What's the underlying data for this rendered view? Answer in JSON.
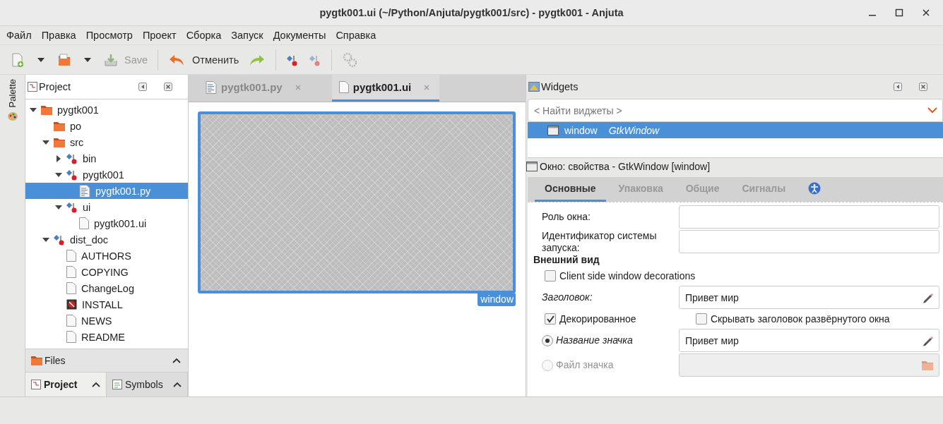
{
  "window": {
    "title": "pygtk001.ui (~/Python/Anjuta/pygtk001/src) - pygtk001 - Anjuta"
  },
  "menu": [
    "Файл",
    "Правка",
    "Просмотр",
    "Проект",
    "Сборка",
    "Запуск",
    "Документы",
    "Справка"
  ],
  "toolbar": [
    {
      "kind": "new"
    },
    {
      "kind": "dropdown"
    },
    {
      "kind": "open"
    },
    {
      "kind": "dropdown"
    },
    {
      "kind": "save",
      "label": "Save",
      "disabled": true
    },
    {
      "kind": "separator"
    },
    {
      "kind": "undo",
      "label": "Отменить",
      "disabled": false
    },
    {
      "kind": "redo",
      "disabled": false
    },
    {
      "kind": "separator"
    },
    {
      "kind": "build",
      "disabled": false
    },
    {
      "kind": "build",
      "disabled": true
    },
    {
      "kind": "separator"
    },
    {
      "kind": "gears",
      "disabled": true
    }
  ],
  "palette": {
    "label": "Palette"
  },
  "project": {
    "title": "Project",
    "tree": [
      {
        "label": "pygtk001",
        "kind": "folder",
        "expanded": true,
        "selected": false,
        "children": [
          {
            "label": "po",
            "kind": "folder",
            "selected": false
          },
          {
            "label": "src",
            "kind": "folder",
            "expanded": true,
            "selected": false,
            "children": [
              {
                "label": "bin",
                "kind": "target",
                "expanded": false,
                "selected": false
              },
              {
                "label": "pygtk001",
                "kind": "target",
                "expanded": true,
                "selected": false,
                "children": [
                  {
                    "label": "pygtk001.py",
                    "kind": "code",
                    "selected": true
                  }
                ]
              },
              {
                "label": "ui",
                "kind": "target",
                "expanded": true,
                "selected": false,
                "children": [
                  {
                    "label": "pygtk001.ui",
                    "kind": "file",
                    "selected": false
                  }
                ]
              }
            ]
          },
          {
            "label": "dist_doc",
            "kind": "target",
            "expanded": true,
            "selected": false,
            "children": [
              {
                "label": "AUTHORS",
                "kind": "file",
                "selected": false
              },
              {
                "label": "COPYING",
                "kind": "file",
                "selected": false
              },
              {
                "label": "ChangeLog",
                "kind": "file",
                "selected": false
              },
              {
                "label": "INSTALL",
                "kind": "error",
                "selected": false
              },
              {
                "label": "NEWS",
                "kind": "file",
                "selected": false
              },
              {
                "label": "README",
                "kind": "file",
                "selected": false
              }
            ]
          }
        ]
      }
    ],
    "files_bar": "Files",
    "bottom_tabs": [
      {
        "label": "Project",
        "selected": true
      },
      {
        "label": "Symbols",
        "selected": false
      }
    ]
  },
  "editor": {
    "tabs": [
      {
        "label": "pygtk001.py",
        "kind": "code",
        "selected": false
      },
      {
        "label": "pygtk001.ui",
        "kind": "file",
        "selected": true
      }
    ],
    "preview_label": "window"
  },
  "widgets": {
    "title": "Widgets",
    "search": {
      "placeholder": "< Найти виджеты >"
    },
    "rows": [
      {
        "name": "window",
        "type": "GtkWindow",
        "selected": true
      }
    ]
  },
  "properties": {
    "title": "Окно: свойства - GtkWindow [window]",
    "tabs": [
      {
        "label": "Основные",
        "selected": true
      },
      {
        "label": "Упаковка",
        "selected": false
      },
      {
        "label": "Общие",
        "selected": false
      },
      {
        "label": "Сигналы",
        "selected": false
      },
      {
        "kind": "accessibility",
        "selected": false
      }
    ],
    "rows": [
      {
        "kind": "field",
        "label": "Роль окна:",
        "italic": false
      },
      {
        "kind": "field",
        "label": "Идентификатор системы запуска:",
        "italic": false
      },
      {
        "kind": "section",
        "label": "Внешний вид"
      },
      {
        "kind": "check",
        "label": "Client side window decorations",
        "checked": false
      },
      {
        "kind": "edit-field",
        "label": "Заголовок:",
        "italic": true,
        "value": "Привет мир"
      },
      {
        "kind": "check-pair",
        "label": "Декорированное",
        "checked": true,
        "label2": "Скрывать заголовок развёрнутого окна",
        "checked2": false
      },
      {
        "kind": "radio-edit-field",
        "label": "Название значка",
        "italic": true,
        "selected": true,
        "disabled": false,
        "value": "Привет мир"
      },
      {
        "kind": "radio-file-field",
        "label": "Файл значка",
        "italic": false,
        "selected": false,
        "disabled": true
      }
    ]
  }
}
